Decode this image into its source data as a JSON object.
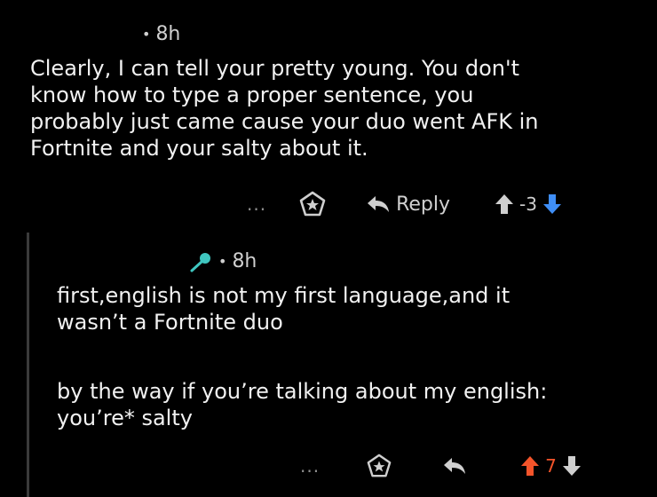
{
  "comment1": {
    "time": "8h",
    "text": "Clearly, I can tell your pretty young. You don't\nknow how to type a proper sentence, you\nprobably just came cause your duo went AFK in\nFortnite and your salty about it.",
    "more": "...",
    "reply_label": "Reply",
    "score": "-3",
    "colors": {
      "score": "#d0d0d0",
      "downvote": "#3f8ef6",
      "upvote": "#cfcfcf"
    }
  },
  "comment2": {
    "time": "8h",
    "paragraph1": "first,english is not my first language,and it\nwasn’t a Fortnite duo",
    "paragraph2": "by the way if you’re talking about my english:\nyou’re* salty",
    "more": "...",
    "score": "7",
    "colors": {
      "upvote": "#f4542a",
      "score": "#f4542a",
      "downvote": "#cfcfcf",
      "badge": "#3fc6c0"
    }
  }
}
